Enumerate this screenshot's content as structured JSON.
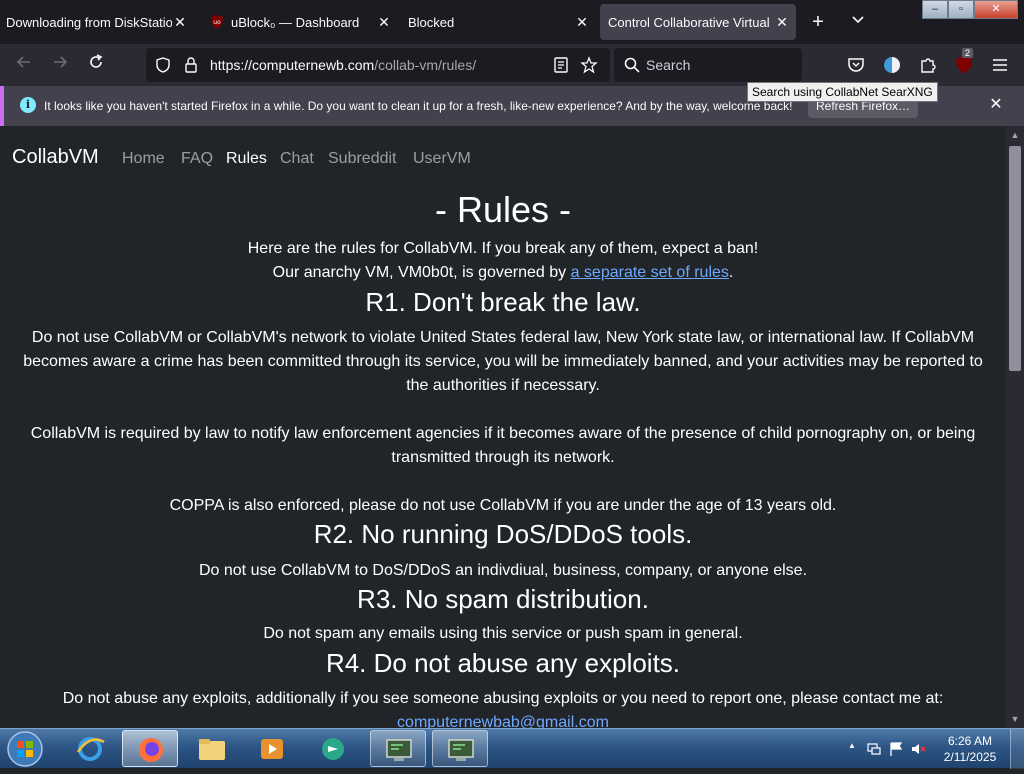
{
  "tabs": [
    {
      "label": "Downloading from DiskStation",
      "favicon": "download-icon"
    },
    {
      "label": "uBlock₀ — Dashboard",
      "favicon": "ublock-icon"
    },
    {
      "label": "Blocked",
      "favicon": "blocked-icon"
    },
    {
      "label": "Control Collaborative Virtual M",
      "favicon": "collabvm-icon",
      "active": true
    }
  ],
  "window_controls": {
    "minimize": "–",
    "maximize": "▫",
    "close": "✕"
  },
  "navbar": {
    "url_host": "https://computernewb.com",
    "url_path": "/collab-vm/rules/",
    "search_placeholder": "Search",
    "tooltip": "Search using CollabNet SearXNG",
    "extension_badge": "2"
  },
  "notification": {
    "text": "It looks like you haven't started Firefox in a while. Do you want to clean it up for a fresh, like-new experience? And by the way, welcome back!",
    "button": "Refresh Firefox…"
  },
  "site": {
    "brand": "CollabVM",
    "nav": [
      "Home",
      "FAQ",
      "Rules",
      "Chat",
      "Subreddit",
      "UserVM"
    ],
    "active_nav": "Rules"
  },
  "page": {
    "title": "- Rules -",
    "intro_1": "Here are the rules for CollabVM. If you break any of them, expect a ban!",
    "intro_2_prefix": "Our anarchy VM, VM0b0t, is governed by ",
    "intro_2_link": "a separate set of rules",
    "intro_2_suffix": ".",
    "r1_title": "R1. Don't break the law.",
    "r1_p1": "Do not use CollabVM or CollabVM's network to violate United States federal law, New York state law, or international law. If CollabVM becomes aware a crime has been committed through its service, you will be immediately banned, and your activities may be reported to the authorities if necessary.",
    "r1_p2": "CollabVM is required by law to notify law enforcement agencies if it becomes aware of the presence of child pornography on, or being transmitted through its network.",
    "r1_p3": "COPPA is also enforced, please do not use CollabVM if you are under the age of 13 years old.",
    "r2_title": "R2. No running DoS/DDoS tools.",
    "r2_p1": "Do not use CollabVM to DoS/DDoS an indivdiual, business, company, or anyone else.",
    "r3_title": "R3. No spam distribution.",
    "r3_p1": "Do not spam any emails using this service or push spam in general.",
    "r4_title": "R4. Do not abuse any exploits.",
    "r4_p1": "Do not abuse any exploits, additionally if you see someone abusing exploits or you need to report one, please contact me at:",
    "r4_email": "computernewbab@gmail.com"
  },
  "taskbar": {
    "time": "6:26 AM",
    "date": "2/11/2025"
  }
}
